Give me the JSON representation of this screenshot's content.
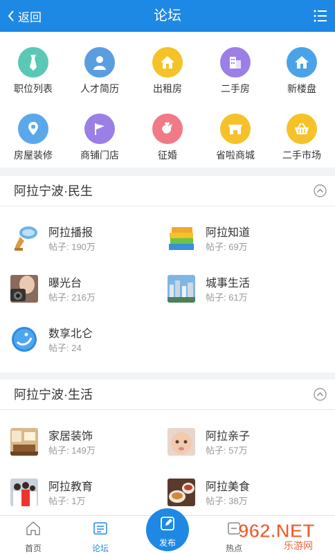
{
  "header": {
    "back_label": "返回",
    "title": "论坛"
  },
  "categories": [
    {
      "label": "职位列表",
      "icon": "tie-icon",
      "color": "#5ac8b4"
    },
    {
      "label": "人才简历",
      "icon": "person-icon",
      "color": "#5a9ee0"
    },
    {
      "label": "出租房",
      "icon": "house-icon",
      "color": "#f5c22a"
    },
    {
      "label": "二手房",
      "icon": "building-icon",
      "color": "#9b7fe6"
    },
    {
      "label": "新楼盘",
      "icon": "new-house-icon",
      "color": "#4aa3e8"
    },
    {
      "label": "房屋装修",
      "icon": "location-pin-icon",
      "color": "#5aa8ea"
    },
    {
      "label": "商铺门店",
      "icon": "flag-icon",
      "color": "#9b7fe6"
    },
    {
      "label": "征婚",
      "icon": "bird-icon",
      "color": "#f07a86"
    },
    {
      "label": "省啦商城",
      "icon": "shop-icon",
      "color": "#f5c22a"
    },
    {
      "label": "二手市场",
      "icon": "basket-icon",
      "color": "#f5c22a"
    }
  ],
  "sections": [
    {
      "title": "阿拉宁波·民生",
      "forums": [
        {
          "name": "阿拉播报",
          "posts": "帖子: 190万",
          "icon": "megaphone-icon"
        },
        {
          "name": "阿拉知道",
          "posts": "帖子: 69万",
          "icon": "books-icon"
        },
        {
          "name": "曝光台",
          "posts": "帖子: 216万",
          "icon": "camera-icon"
        },
        {
          "name": "城事生活",
          "posts": "帖子: 61万",
          "icon": "city-icon"
        },
        {
          "name": "数享北仑",
          "posts": "帖子: 24",
          "icon": "app-logo-icon"
        }
      ]
    },
    {
      "title": "阿拉宁波·生活",
      "forums": [
        {
          "name": "家居装饰",
          "posts": "帖子: 149万",
          "icon": "living-room-icon"
        },
        {
          "name": "阿拉亲子",
          "posts": "帖子: 57万",
          "icon": "baby-icon"
        },
        {
          "name": "阿拉教育",
          "posts": "帖子: 1万",
          "icon": "students-icon"
        },
        {
          "name": "阿拉美食",
          "posts": "帖子: 38万",
          "icon": "food-icon"
        }
      ]
    }
  ],
  "bottom_nav": {
    "home": "首页",
    "forum": "论坛",
    "publish": "发布",
    "hot": "热点"
  },
  "watermark": {
    "main": "962.NET",
    "sub": "乐游网"
  },
  "colors": {
    "primary": "#1e88e5",
    "background": "#f2f3f5"
  }
}
